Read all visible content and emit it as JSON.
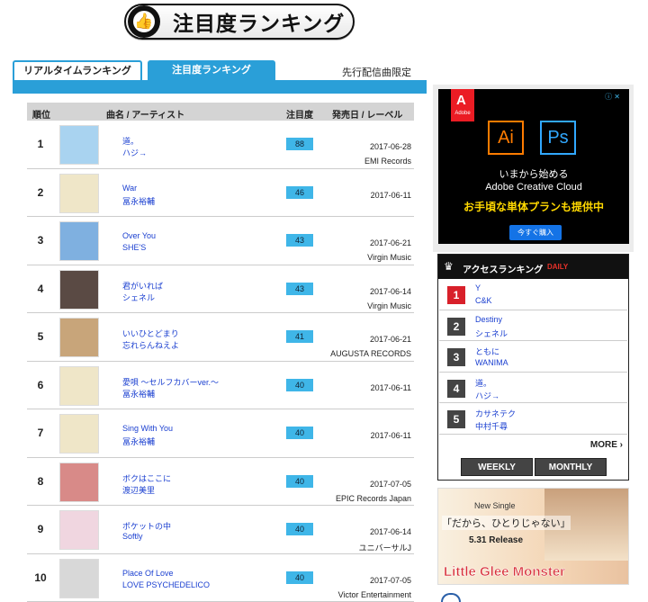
{
  "banner": {
    "title": "注目度ランキング",
    "icon": "thumbs-up-icon"
  },
  "tabs": [
    {
      "label": "リアルタイムランキング",
      "active": false
    },
    {
      "label": "注目度ランキング",
      "active": true
    }
  ],
  "note": "先行配信曲限定",
  "table": {
    "headers": {
      "rank": "順位",
      "song": "曲名 / アーティスト",
      "score": "注目度",
      "release": "発売日 / レーベル"
    },
    "rows": [
      {
        "rank": "1",
        "song": "道。",
        "artist": "ハジ→",
        "score": "88",
        "date": "2017-06-28",
        "label": "EMI Records",
        "jacket": "#a9d3f0"
      },
      {
        "rank": "2",
        "song": "War",
        "artist": "冨永裕輔",
        "score": "46",
        "date": "2017-06-11",
        "label": "",
        "jacket": "#efe6c8"
      },
      {
        "rank": "3",
        "song": "Over You",
        "artist": "SHE'S",
        "score": "43",
        "date": "2017-06-21",
        "label": "Virgin Music",
        "jacket": "#7fb0e0"
      },
      {
        "rank": "4",
        "song": "君がいれば",
        "artist": "シェネル",
        "score": "43",
        "date": "2017-06-14",
        "label": "Virgin Music",
        "jacket": "#5a4a44"
      },
      {
        "rank": "5",
        "song": "いいひとどまり",
        "artist": "忘れらんねえよ",
        "score": "41",
        "date": "2017-06-21",
        "label": "AUGUSTA RECORDS",
        "jacket": "#c8a57a"
      },
      {
        "rank": "6",
        "song": "愛唄 ～セルフカバーver.～",
        "artist": "冨永裕輔",
        "score": "40",
        "date": "2017-06-11",
        "label": "",
        "jacket": "#efe6c8"
      },
      {
        "rank": "7",
        "song": "Sing With You",
        "artist": "冨永裕輔",
        "score": "40",
        "date": "2017-06-11",
        "label": "",
        "jacket": "#efe6c8"
      },
      {
        "rank": "8",
        "song": "ボクはここに",
        "artist": "渡辺美里",
        "score": "40",
        "date": "2017-07-05",
        "label": "EPIC Records Japan",
        "jacket": "#d88a88"
      },
      {
        "rank": "9",
        "song": "ポケットの中",
        "artist": "Softly",
        "score": "40",
        "date": "2017-06-14",
        "label": "ユニバーサルJ",
        "jacket": "#f0d6e0"
      },
      {
        "rank": "10",
        "song": "Place Of Love",
        "artist": "LOVE PSYCHEDELICO",
        "score": "40",
        "date": "2017-07-05",
        "label": "Victor Entertainment",
        "jacket": "#d8d8d8"
      }
    ]
  },
  "ad_adobe": {
    "brand": "Adobe",
    "ai": "Ai",
    "ps": "Ps",
    "line1": "いまから始める",
    "line2": "Adobe Creative Cloud",
    "line3": "お手頃な単体プランも提供中",
    "button": "今すぐ購入"
  },
  "access_ranking": {
    "title": "アクセスランキング",
    "badge": "DAILY",
    "items": [
      {
        "num": "1",
        "song": "Y",
        "artist": "C&K"
      },
      {
        "num": "2",
        "song": "Destiny",
        "artist": "シェネル"
      },
      {
        "num": "3",
        "song": "ともに",
        "artist": "WANIMA"
      },
      {
        "num": "4",
        "song": "道。",
        "artist": "ハジ→"
      },
      {
        "num": "5",
        "song": "カサネテク",
        "artist": "中村千尋"
      }
    ],
    "more": "MORE",
    "weekly": "WEEKLY",
    "monthly": "MONTHLY"
  },
  "ad_lgm": {
    "new_single": "New Single",
    "title": "「だから、ひとりじゃない」",
    "date": "5.31 Release",
    "band": "Little Glee Monster"
  },
  "colors": {
    "accent": "#2a9fd8",
    "score_bg": "#3fb6e8",
    "link": "#1a3fd0",
    "rank1": "#d8202a"
  }
}
